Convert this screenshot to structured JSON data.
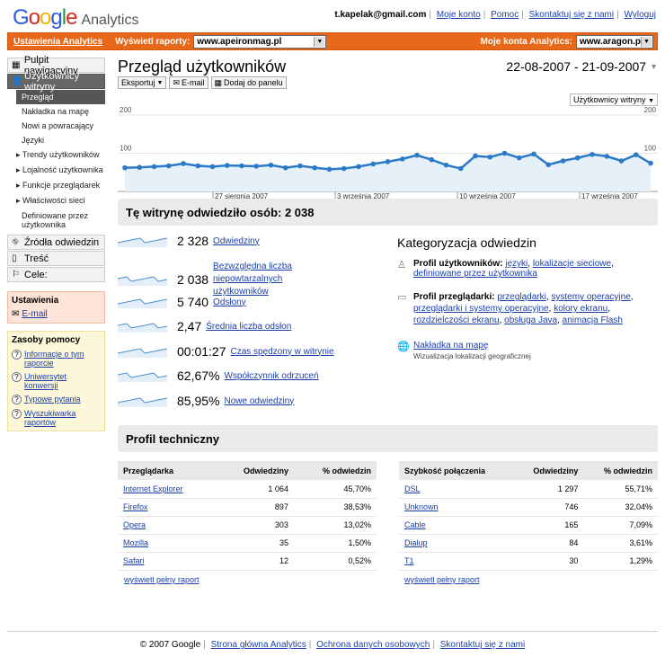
{
  "header": {
    "logo": "Google",
    "logo_sub": "Analytics",
    "email": "t.kapelak@gmail.com",
    "links": [
      "Moje konto",
      "Pomoc",
      "Skontaktuj się z nami",
      "Wyloguj"
    ]
  },
  "bar": {
    "settings": "Ustawienia Analytics",
    "show_reports": "Wyświetl raporty:",
    "site": "www.apeironmag.pl",
    "my_accounts": "Moje konta Analytics:",
    "account": "www.aragon.pl"
  },
  "sidebar": {
    "dashboard": "Pulpit nawigacyjny",
    "visitors": "Użytkownicy witryny",
    "sub": [
      "Przegląd",
      "Nakładka na mapę",
      "Nowi a powracający",
      "Języki",
      "Trendy użytkowników",
      "Lojalność użytkownika",
      "Funkcje przeglądarek",
      "Właściwości sieci",
      "Definiowane przez użytkownika"
    ],
    "sources": "Źródła odwiedzin",
    "content": "Treść",
    "goals": "Cele:",
    "settings_title": "Ustawienia",
    "settings_email": "E-mail",
    "help_title": "Zasoby pomocy",
    "help": [
      "Informacje o tym raporcie",
      "Uniwersytet konwersji",
      "Typowe pytania",
      "Wyszukiwarka raportów"
    ]
  },
  "main": {
    "title": "Przegląd użytkowników",
    "daterange": "22-08-2007 - 21-09-2007",
    "export": "Eksportuj",
    "email": "E-mail",
    "add": "Dodaj do panelu",
    "metric": "Użytkownicy witryny",
    "visited": "Tę witrynę odwiedziło osób: 2 038",
    "stats": [
      {
        "v": "2 328",
        "l": "Odwiedziny"
      },
      {
        "v": "2 038",
        "l": "Bezwzględna liczba niepowtarzalnych użytkowników"
      },
      {
        "v": "5 740",
        "l": "Odsłony"
      },
      {
        "v": "2,47",
        "l": "Średnia liczba odsłon"
      },
      {
        "v": "00:01:27",
        "l": "Czas spędzony w witrynie"
      },
      {
        "v": "62,67%",
        "l": "Współczynnik odrzuceń"
      },
      {
        "v": "85,95%",
        "l": "Nowe odwiedziny"
      }
    ],
    "cat_title": "Kategoryzacja odwiedzin",
    "cat_user_label": "Profil użytkowników:",
    "cat_user_links": [
      "języki",
      "lokalizacje sieciowe",
      "definiowane przez użytkownika"
    ],
    "cat_browser_label": "Profil przeglądarki:",
    "cat_browser_links": [
      "przeglądarki",
      "systemy operacyjne",
      "przeglądarki i systemy operacyjne",
      "kolory ekranu",
      "rozdzielczości ekranu",
      "obsługa Java",
      "animacja Flash"
    ],
    "cat_map_label": "Nakładka na mapę",
    "cat_map_desc": "Wizualizacja lokalizacji geograficznej",
    "tech_title": "Profil techniczny",
    "browsers": {
      "headers": [
        "Przeglądarka",
        "Odwiedziny",
        "% odwiedzin"
      ],
      "rows": [
        [
          "Internet Explorer",
          "1 064",
          "45,70%"
        ],
        [
          "Firefox",
          "897",
          "38,53%"
        ],
        [
          "Opera",
          "303",
          "13,02%"
        ],
        [
          "Mozilla",
          "35",
          "1,50%"
        ],
        [
          "Safari",
          "12",
          "0,52%"
        ]
      ]
    },
    "conn": {
      "headers": [
        "Szybkość połączenia",
        "Odwiedziny",
        "% odwiedzin"
      ],
      "rows": [
        [
          "DSL",
          "1 297",
          "55,71%"
        ],
        [
          "Unknown",
          "746",
          "32,04%"
        ],
        [
          "Cable",
          "165",
          "7,09%"
        ],
        [
          "Dialup",
          "84",
          "3,61%"
        ],
        [
          "T1",
          "30",
          "1,29%"
        ]
      ]
    },
    "full_report": "wyświetl pełny raport"
  },
  "footer": {
    "copy": "© 2007 Google",
    "links": [
      "Strona główna Analytics",
      "Ochrona danych osobowych",
      "Skontaktuj się z nami"
    ]
  },
  "chart_data": {
    "type": "area",
    "xlabels": [
      "27 sierpnia 2007",
      "3 września 2007",
      "10 września 2007",
      "17 września 2007"
    ],
    "yticks": [
      100,
      200
    ],
    "ylim": [
      0,
      200
    ],
    "values": [
      62,
      63,
      65,
      67,
      73,
      67,
      65,
      68,
      67,
      66,
      69,
      62,
      67,
      62,
      58,
      60,
      65,
      72,
      78,
      85,
      95,
      83,
      69,
      60,
      93,
      90,
      100,
      88,
      98,
      70,
      80,
      88,
      97,
      92,
      80,
      96,
      74
    ]
  }
}
